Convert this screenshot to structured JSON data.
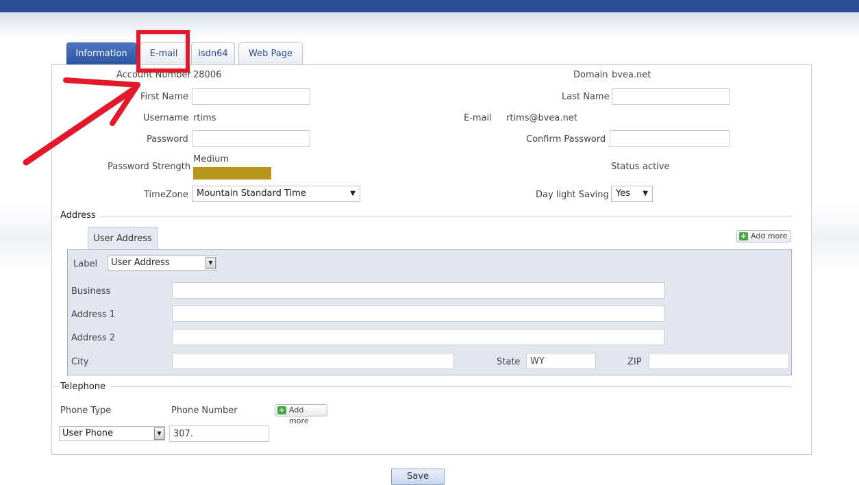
{
  "tabs": [
    "Information",
    "E-mail",
    "isdn64",
    "Web Page"
  ],
  "account": {
    "account_number_label": "Account Number",
    "account_number": "28006",
    "domain_label": "Domain",
    "domain": "bvea.net",
    "first_name_label": "First Name",
    "first_name": "",
    "last_name_label": "Last Name",
    "last_name": "",
    "username_label": "Username",
    "username": "rtims",
    "email_label": "E-mail",
    "email": "rtims@bvea.net",
    "password_label": "Password",
    "confirm_password_label": "Confirm Password",
    "password_strength_label": "Password Strength",
    "password_strength": "Medium",
    "status_label": "Status",
    "status": "active",
    "timezone_label": "TimeZone",
    "timezone": "Mountain Standard Time",
    "daylight_label": "Day light Saving",
    "daylight": "Yes"
  },
  "address": {
    "section_title": "Address",
    "subtab": "User Address",
    "add_more": "Add more",
    "label_label": "Label",
    "label_value": "User Address",
    "business_label": "Business",
    "business": "",
    "address1_label": "Address 1",
    "address1": "",
    "address2_label": "Address 2",
    "address2": "",
    "city_label": "City",
    "city": "",
    "state_label": "State",
    "state": "WY",
    "zip_label": "ZIP",
    "zip": ""
  },
  "telephone": {
    "section_title": "Telephone",
    "phone_type_label": "Phone Type",
    "phone_number_label": "Phone Number",
    "add_more": "Add more",
    "phone_type": "User Phone",
    "phone_number": "307."
  },
  "save_label": "Save",
  "colors": {
    "header": "#2b4c92",
    "annotation": "#e3192b",
    "strength": "#b8961c"
  }
}
